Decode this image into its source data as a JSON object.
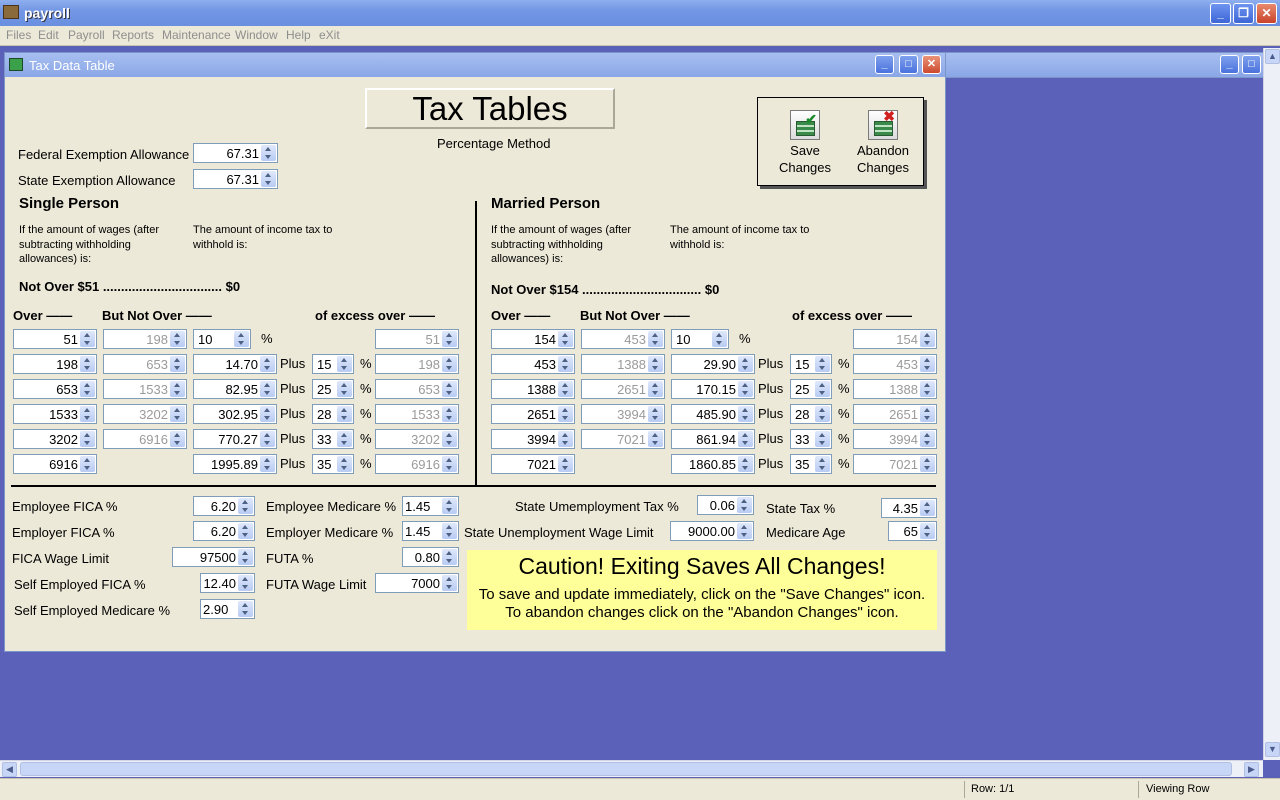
{
  "app": {
    "title": "payroll"
  },
  "menu": [
    "Files",
    "Edit",
    "Payroll",
    "Reports",
    "Maintenance",
    "Window",
    "Help",
    "eXit"
  ],
  "window": {
    "title": "Tax Data Table"
  },
  "heading": {
    "title": "Tax Tables",
    "subtitle": "Percentage Method"
  },
  "toolbar": {
    "save_line1": "Save",
    "save_line2": "Changes",
    "abandon_line1": "Abandon",
    "abandon_line2": "Changes"
  },
  "exemptions": {
    "federal_label": "Federal Exemption Allowance",
    "federal_value": "67.31",
    "state_label": "State Exemption Allowance",
    "state_value": "67.31"
  },
  "single": {
    "title": "Single Person",
    "wage_note": [
      "If the amount of wages (after",
      "subtracting withholding",
      "allowances) is:"
    ],
    "tax_note": [
      "The amount of income tax to",
      "withhold is:"
    ],
    "not_over": "Not Over $51 ................................. $0",
    "hdr_over": "Over  ——",
    "hdr_but": "But Not Over  ——",
    "hdr_excess": "of excess over  ——",
    "rows": [
      {
        "over": "51",
        "but": "198",
        "tax": "10",
        "plus": "",
        "pct": "",
        "excess": "51"
      },
      {
        "over": "198",
        "but": "653",
        "tax": "14.70",
        "plus": "Plus",
        "pct": "15",
        "excess": "198"
      },
      {
        "over": "653",
        "but": "1533",
        "tax": "82.95",
        "plus": "Plus",
        "pct": "25",
        "excess": "653"
      },
      {
        "over": "1533",
        "but": "3202",
        "tax": "302.95",
        "plus": "Plus",
        "pct": "28",
        "excess": "1533"
      },
      {
        "over": "3202",
        "but": "6916",
        "tax": "770.27",
        "plus": "Plus",
        "pct": "33",
        "excess": "3202"
      },
      {
        "over": "6916",
        "but": "",
        "tax": "1995.89",
        "plus": "Plus",
        "pct": "35",
        "excess": "6916"
      }
    ]
  },
  "married": {
    "title": "Married Person",
    "wage_note": [
      "If the amount of wages (after",
      "subtracting withholding",
      "allowances) is:"
    ],
    "tax_note": [
      "The amount of income tax to",
      "withhold is:"
    ],
    "not_over": "Not Over $154 ................................. $0",
    "hdr_over": "Over  ——",
    "hdr_but": "But Not Over  ——",
    "hdr_excess": "of excess over  ——",
    "rows": [
      {
        "over": "154",
        "but": "453",
        "tax": "10",
        "plus": "",
        "pct": "",
        "excess": "154"
      },
      {
        "over": "453",
        "but": "1388",
        "tax": "29.90",
        "plus": "Plus",
        "pct": "15",
        "excess": "453"
      },
      {
        "over": "1388",
        "but": "2651",
        "tax": "170.15",
        "plus": "Plus",
        "pct": "25",
        "excess": "1388"
      },
      {
        "over": "2651",
        "but": "3994",
        "tax": "485.90",
        "plus": "Plus",
        "pct": "28",
        "excess": "2651"
      },
      {
        "over": "3994",
        "but": "7021",
        "tax": "861.94",
        "plus": "Plus",
        "pct": "33",
        "excess": "3994"
      },
      {
        "over": "7021",
        "but": "",
        "tax": "1860.85",
        "plus": "Plus",
        "pct": "35",
        "excess": "7021"
      }
    ]
  },
  "percent_symbol": "%",
  "bottom": {
    "employee_fica_label": "Employee FICA %",
    "employee_fica": "6.20",
    "employer_fica_label": "Employer FICA %",
    "employer_fica": "6.20",
    "fica_wage_label": "FICA Wage Limit",
    "fica_wage": "97500",
    "self_fica_label": "Self Employed FICA %",
    "self_fica": "12.40",
    "self_medicare_label": "Self Employed Medicare %",
    "self_medicare": "2.90",
    "employee_medicare_label": "Employee Medicare %",
    "employee_medicare": "1.45",
    "employer_medicare_label": "Employer Medicare %",
    "employer_medicare": "1.45",
    "futa_label": "FUTA %",
    "futa": "0.80",
    "futa_wage_label": "FUTA Wage Limit",
    "futa_wage": "7000",
    "state_unemp_tax_label": "State Umemployment Tax %",
    "state_unemp_tax": "0.06",
    "state_unemp_wage_label": "State Unemployment  Wage Limit",
    "state_unemp_wage": "9000.00",
    "state_tax_label": "State Tax %",
    "state_tax": "4.35",
    "medicare_age_label": "Medicare Age",
    "medicare_age": "65"
  },
  "caution": {
    "heading": "Caution!  Exiting Saves All Changes!",
    "line1": "To save and update immediately, click on the \"Save Changes\" icon.",
    "line2": "To abandon changes click on the \"Abandon Changes\" icon."
  },
  "status": {
    "row": "Row: 1/1",
    "mode": "Viewing Row"
  }
}
